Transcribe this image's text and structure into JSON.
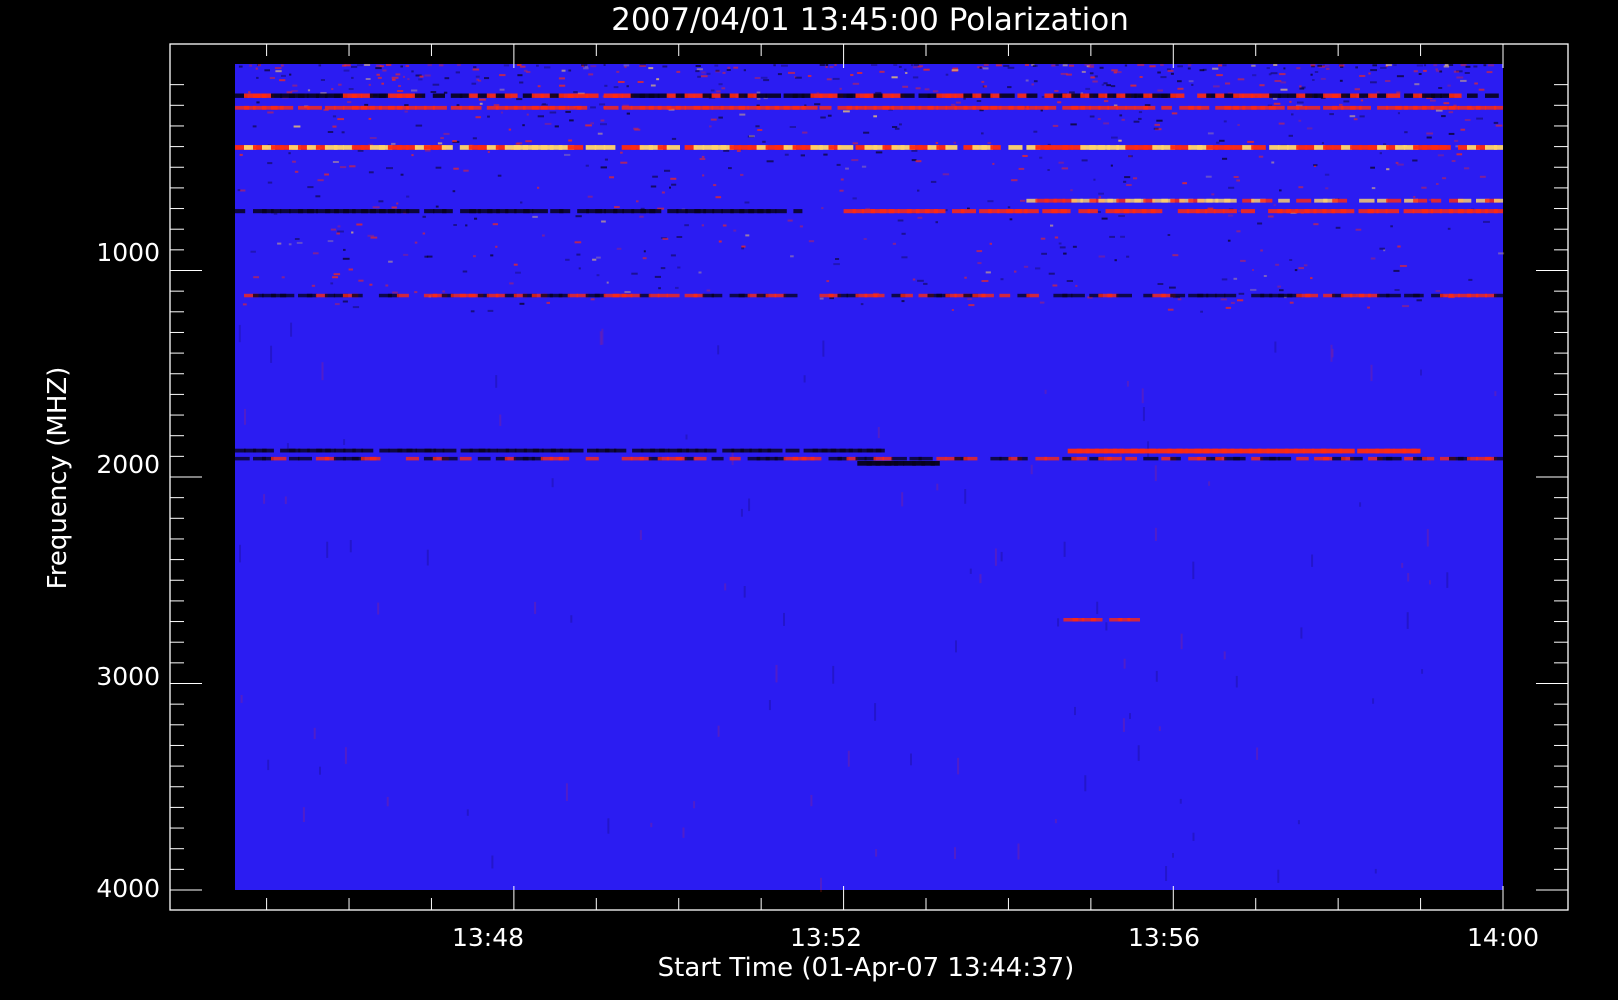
{
  "chart_data": {
    "type": "heatmap",
    "title": "2007/04/01 13:45:00 Polarization",
    "xlabel": "Start Time (01-Apr-07 13:44:37)",
    "ylabel": "Frequency (MHZ)",
    "x_ticks": [
      "13:48",
      "13:52",
      "13:56",
      "14:00"
    ],
    "y_ticks": [
      "1000",
      "2000",
      "3000",
      "4000"
    ],
    "ylim": [
      4000,
      0
    ],
    "y_inverted": true,
    "colors": {
      "background": "#000000",
      "base": "#2b1cf2",
      "positive": "#ff2a10",
      "hot": "#ffd36a",
      "negative": "#07021c"
    },
    "features": [
      {
        "name": "RFI band",
        "freq_mhz": 150,
        "t_start": "13:44:37",
        "t_end": "14:00:00",
        "sign": "mixed",
        "strength": 0.8
      },
      {
        "name": "RFI band",
        "freq_mhz": 210,
        "t_start": "13:44:37",
        "t_end": "14:00:00",
        "sign": "positive",
        "strength": 0.6
      },
      {
        "name": "RFI band",
        "freq_mhz": 400,
        "t_start": "13:44:37",
        "t_end": "14:00:00",
        "sign": "hot",
        "strength": 0.9
      },
      {
        "name": "RFI band",
        "freq_mhz": 660,
        "t_start": "13:54:00",
        "t_end": "14:00:00",
        "sign": "hot",
        "strength": 0.6
      },
      {
        "name": "RFI band",
        "freq_mhz": 710,
        "t_start": "13:44:37",
        "t_end": "13:51:30",
        "sign": "negative",
        "strength": 0.7
      },
      {
        "name": "RFI band",
        "freq_mhz": 710,
        "t_start": "13:52:00",
        "t_end": "14:00:00",
        "sign": "positive",
        "strength": 0.7
      },
      {
        "name": "RFI band",
        "freq_mhz": 1120,
        "t_start": "13:44:37",
        "t_end": "14:00:00",
        "sign": "mixed",
        "strength": 0.5
      },
      {
        "name": "Band",
        "freq_mhz": 1870,
        "t_start": "13:44:37",
        "t_end": "13:52:30",
        "sign": "negative",
        "strength": 0.6
      },
      {
        "name": "Band",
        "freq_mhz": 1870,
        "t_start": "13:54:30",
        "t_end": "13:59:00",
        "sign": "positive",
        "strength": 0.9
      },
      {
        "name": "Band",
        "freq_mhz": 1910,
        "t_start": "13:44:37",
        "t_end": "14:00:00",
        "sign": "mixed",
        "strength": 0.5
      },
      {
        "name": "Band",
        "freq_mhz": 1930,
        "t_start": "13:52:10",
        "t_end": "13:53:10",
        "sign": "negative",
        "strength": 0.9
      },
      {
        "name": "Spot",
        "freq_mhz": 2690,
        "t_start": "13:54:40",
        "t_end": "13:55:40",
        "sign": "positive",
        "strength": 0.5
      }
    ]
  }
}
